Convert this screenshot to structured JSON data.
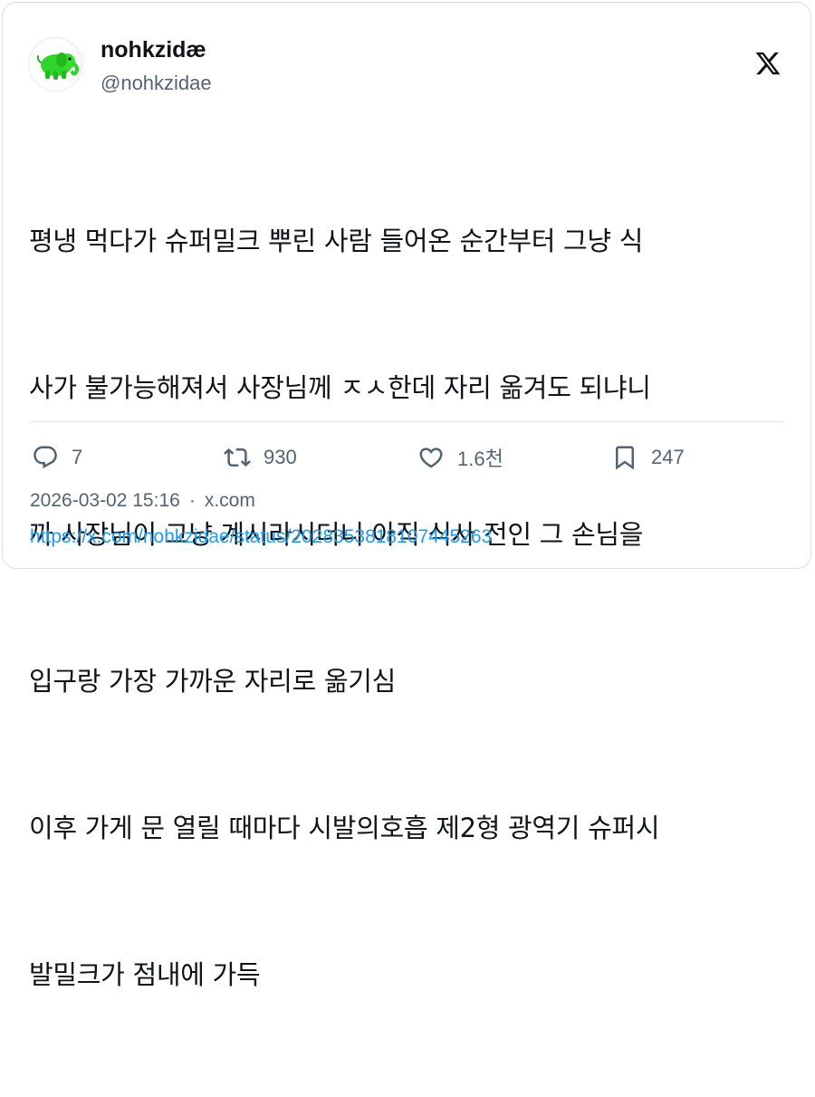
{
  "user": {
    "display_name": "nohkzidæ",
    "handle": "@nohkzidae",
    "avatar_icon": "green-elephant-avatar"
  },
  "platform_icon": "x-logo-icon",
  "tweet": {
    "lines": [
      "평냉 먹다가 슈퍼밀크 뿌린 사람 들어온 순간부터 그냥 식",
      "사가 불가능해져서 사장님께 ㅈㅅ한데 자리 옮겨도 되냐니",
      "까 사장님이 그냥 계시라시더니 아직 식사 전인 그 손님을",
      "입구랑 가장 가까운 자리로 옮기심",
      "이후 가게 문 열릴 때마다 시발의호흡 제2형 광역기 슈퍼시",
      "발밀크가 점내에 가득"
    ]
  },
  "actions": {
    "reply": {
      "icon": "reply-icon",
      "count": "7"
    },
    "repost": {
      "icon": "repost-icon",
      "count": "930"
    },
    "like": {
      "icon": "heart-icon",
      "count": "1.6천"
    },
    "bookmark": {
      "icon": "bookmark-icon",
      "count": "247"
    }
  },
  "meta": {
    "timestamp": "2026-03-02 15:16",
    "separator": "·",
    "source": "x.com"
  },
  "url": "https://x.com/nohkzidae/status/2028353818107445263",
  "colors": {
    "text": "#0f1419",
    "muted": "#536471",
    "link": "#1d9bf0",
    "border": "#d9dde1",
    "avatar_green": "#2fd52a"
  }
}
